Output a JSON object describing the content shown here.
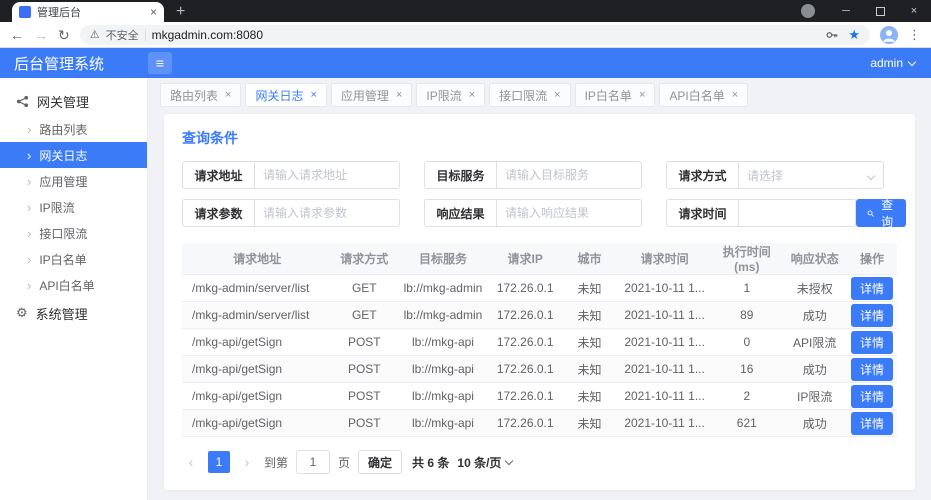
{
  "theme": {
    "primary": "#3b7bf8"
  },
  "icons": {
    "tab_close": "×",
    "new_tab": "+",
    "minimize": "─",
    "close": "×",
    "back": "←",
    "forward": "→",
    "refresh": "↻",
    "warning": "⚠",
    "star": "★",
    "kebab": "⋮",
    "hamburger": "≡",
    "chevron_right": "›",
    "gear": "⚙",
    "prev": "‹",
    "next": "›"
  },
  "browser": {
    "tab_title": "管理后台",
    "security_label": "不安全",
    "url": "mkgadmin.com:8080"
  },
  "app": {
    "title": "后台管理系统",
    "username": "admin"
  },
  "sidebar": {
    "group_gateway": "网关管理",
    "group_system": "系统管理",
    "items": [
      {
        "label": "路由列表"
      },
      {
        "label": "网关日志"
      },
      {
        "label": "应用管理"
      },
      {
        "label": "IP限流"
      },
      {
        "label": "接口限流"
      },
      {
        "label": "IP白名单"
      },
      {
        "label": "API白名单"
      }
    ]
  },
  "tabs": [
    {
      "label": "路由列表"
    },
    {
      "label": "网关日志"
    },
    {
      "label": "应用管理"
    },
    {
      "label": "IP限流"
    },
    {
      "label": "接口限流"
    },
    {
      "label": "IP白名单"
    },
    {
      "label": "API白名单"
    }
  ],
  "query": {
    "title": "查询条件",
    "fields": {
      "request_url": {
        "label": "请求地址",
        "placeholder": "请输入请求地址"
      },
      "target_service": {
        "label": "目标服务",
        "placeholder": "请输入目标服务"
      },
      "request_method": {
        "label": "请求方式",
        "placeholder": "请选择"
      },
      "request_params": {
        "label": "请求参数",
        "placeholder": "请输入请求参数"
      },
      "response_result": {
        "label": "响应结果",
        "placeholder": "请输入响应结果"
      },
      "request_time": {
        "label": "请求时间",
        "placeholder": ""
      }
    },
    "search_label": "查询"
  },
  "table": {
    "columns": [
      "请求地址",
      "请求方式",
      "目标服务",
      "请求IP",
      "城市",
      "请求时间",
      "执行时间(ms)",
      "响应状态",
      "操作"
    ],
    "detail_label": "详情",
    "rows": [
      {
        "url": "/mkg-admin/server/list",
        "method": "GET",
        "service": "lb://mkg-admin",
        "ip": "172.26.0.1",
        "city": "未知",
        "time": "2021-10-11 1...",
        "exec": "1",
        "status": "未授权"
      },
      {
        "url": "/mkg-admin/server/list",
        "method": "GET",
        "service": "lb://mkg-admin",
        "ip": "172.26.0.1",
        "city": "未知",
        "time": "2021-10-11 1...",
        "exec": "89",
        "status": "成功"
      },
      {
        "url": "/mkg-api/getSign",
        "method": "POST",
        "service": "lb://mkg-api",
        "ip": "172.26.0.1",
        "city": "未知",
        "time": "2021-10-11 1...",
        "exec": "0",
        "status": "API限流"
      },
      {
        "url": "/mkg-api/getSign",
        "method": "POST",
        "service": "lb://mkg-api",
        "ip": "172.26.0.1",
        "city": "未知",
        "time": "2021-10-11 1...",
        "exec": "16",
        "status": "成功"
      },
      {
        "url": "/mkg-api/getSign",
        "method": "POST",
        "service": "lb://mkg-api",
        "ip": "172.26.0.1",
        "city": "未知",
        "time": "2021-10-11 1...",
        "exec": "2",
        "status": "IP限流"
      },
      {
        "url": "/mkg-api/getSign",
        "method": "POST",
        "service": "lb://mkg-api",
        "ip": "172.26.0.1",
        "city": "未知",
        "time": "2021-10-11 1...",
        "exec": "621",
        "status": "成功"
      }
    ]
  },
  "pagination": {
    "current_page": "1",
    "goto_label": "到第",
    "goto_value": "1",
    "page_unit_label": "页",
    "confirm_label": "确定",
    "total_label": "共 6 条",
    "page_size_label": "10 条/页"
  }
}
